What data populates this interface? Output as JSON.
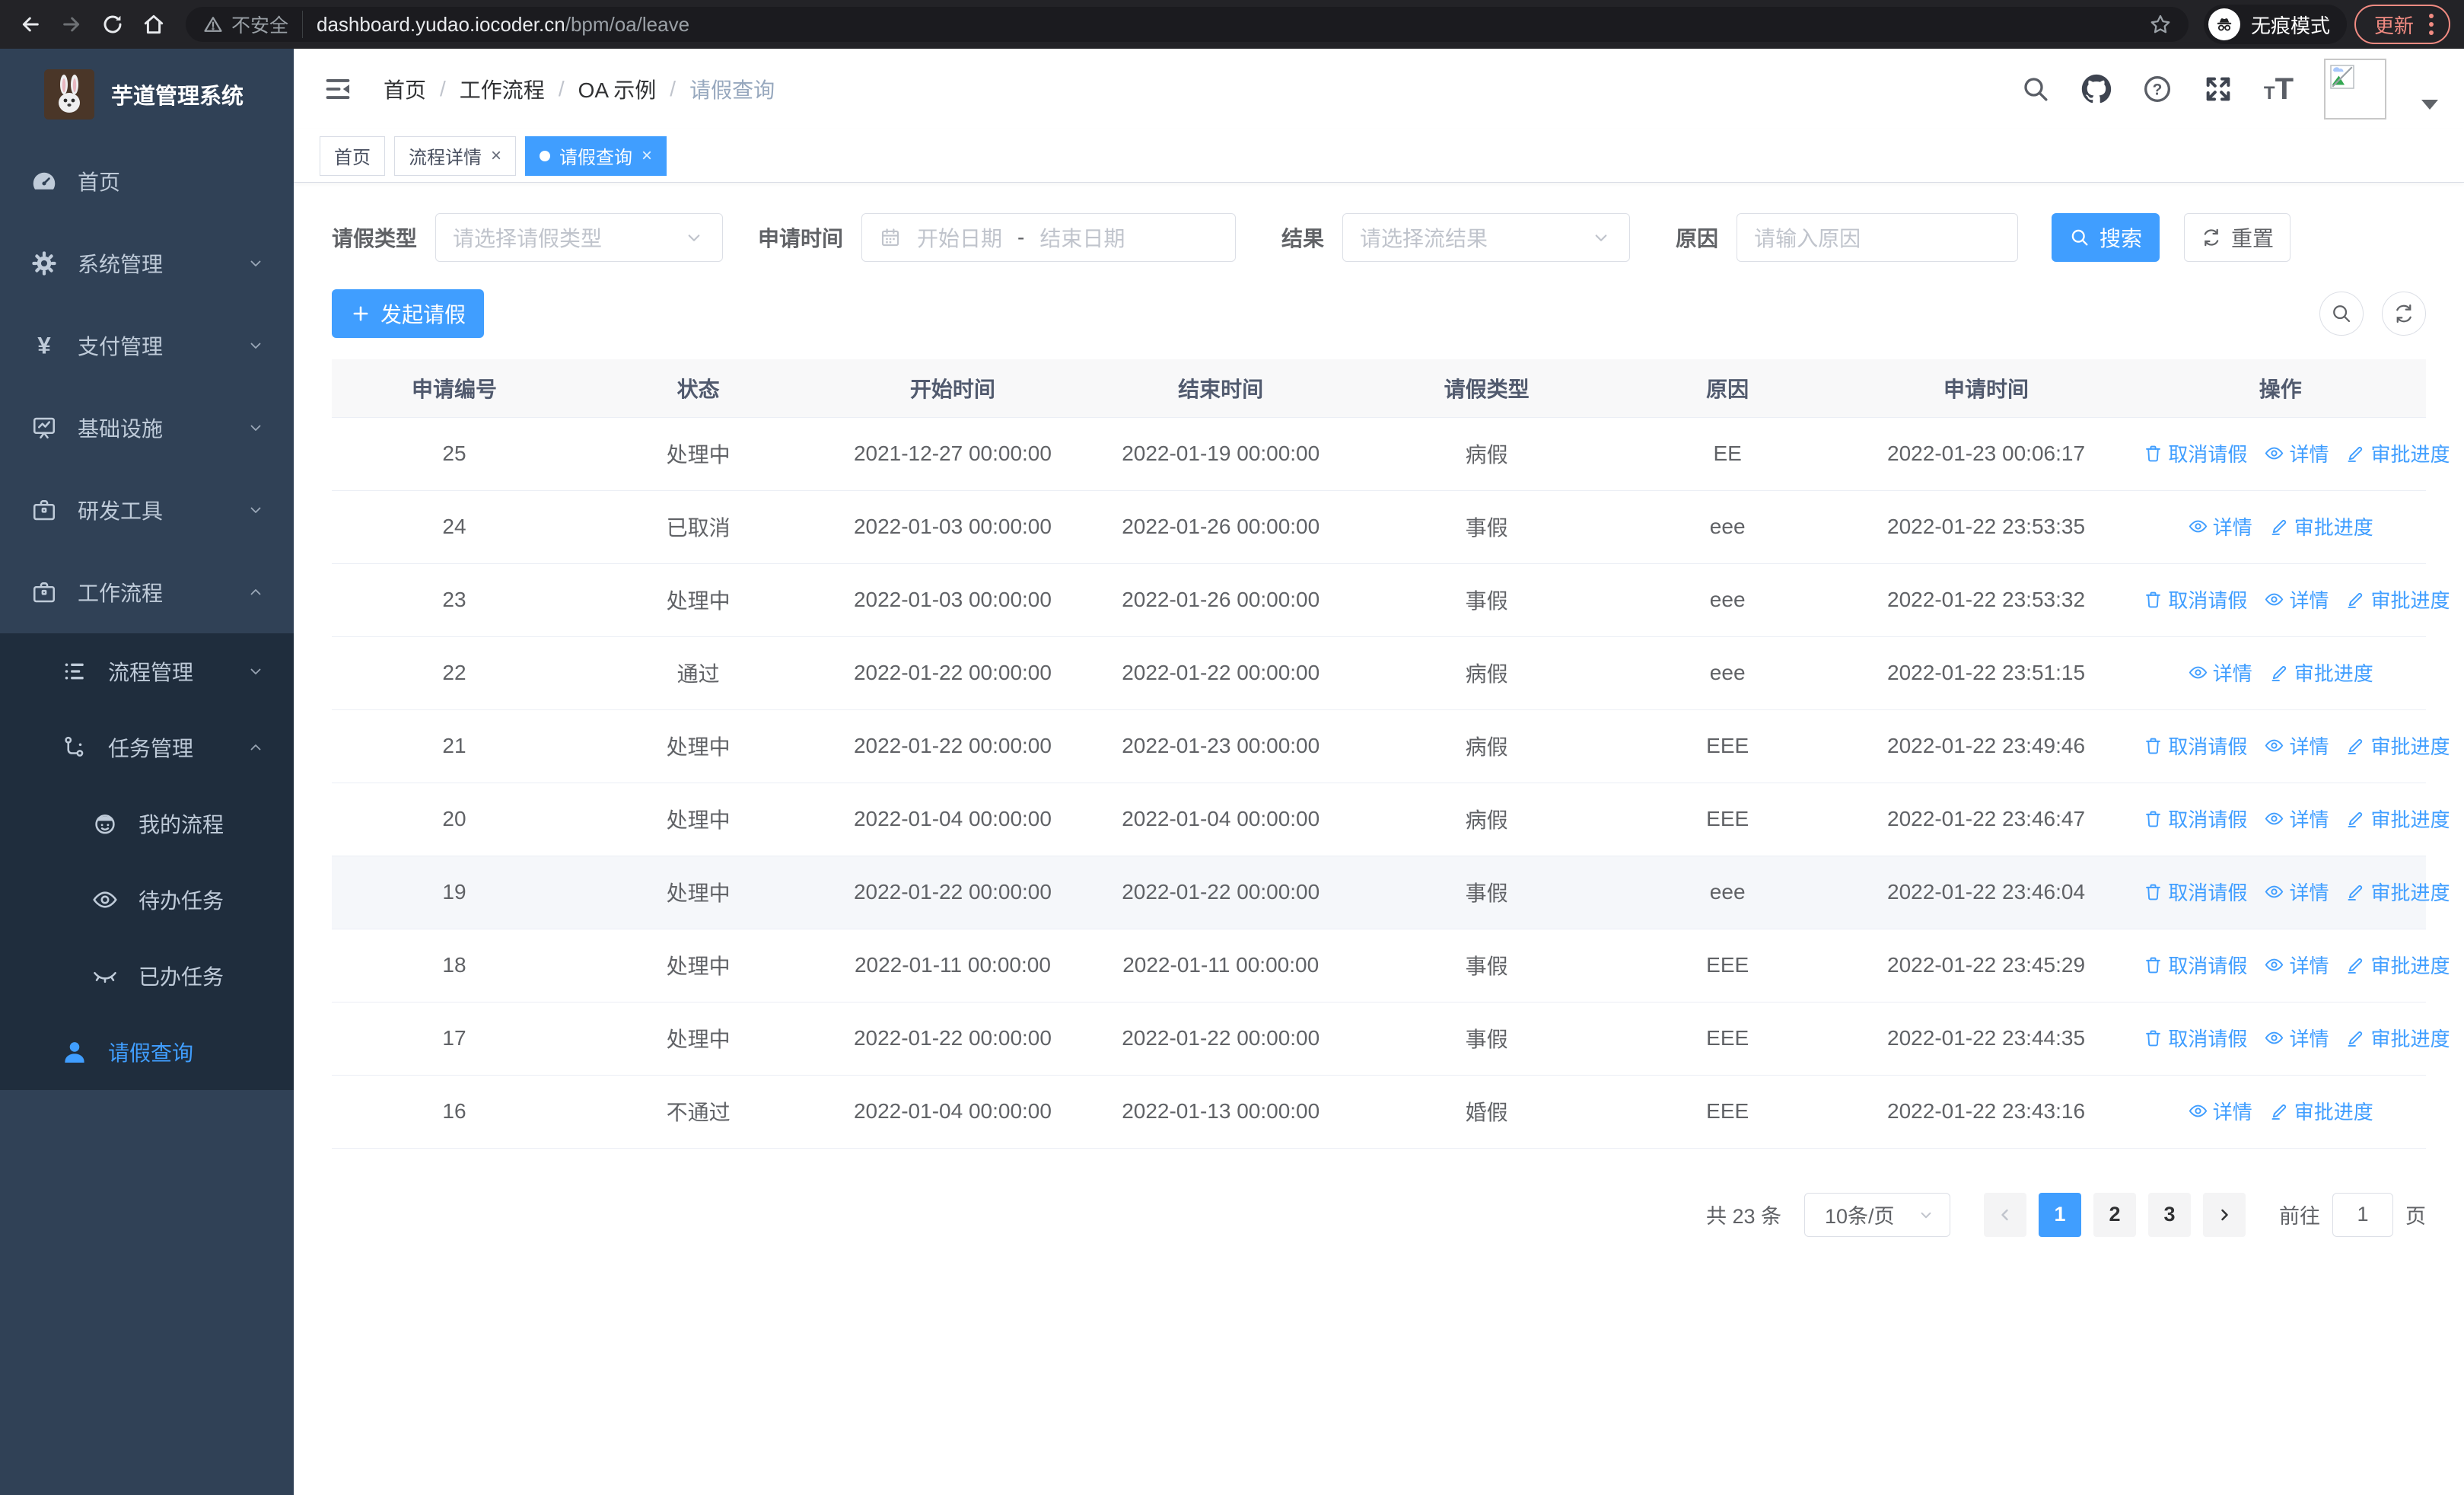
{
  "browser": {
    "security_label": "不安全",
    "url_host": "dashboard.yudao.iocoder.cn",
    "url_path": "/bpm/oa/leave",
    "incognito_label": "无痕模式",
    "update_label": "更新"
  },
  "sidebar": {
    "title": "芋道管理系统",
    "items": [
      {
        "label": "首页",
        "icon": "gauge-icon",
        "level": 1,
        "arrow": null,
        "submenu": false,
        "active": false
      },
      {
        "label": "系统管理",
        "icon": "gear-icon",
        "level": 1,
        "arrow": "down",
        "submenu": false,
        "active": false
      },
      {
        "label": "支付管理",
        "icon": "yen-icon",
        "level": 1,
        "arrow": "down",
        "submenu": false,
        "active": false
      },
      {
        "label": "基础设施",
        "icon": "monitor-icon",
        "level": 1,
        "arrow": "down",
        "submenu": false,
        "active": false
      },
      {
        "label": "研发工具",
        "icon": "briefcase-icon",
        "level": 1,
        "arrow": "down",
        "submenu": false,
        "active": false
      },
      {
        "label": "工作流程",
        "icon": "briefcase-icon",
        "level": 1,
        "arrow": "up",
        "submenu": false,
        "active": false
      },
      {
        "label": "流程管理",
        "icon": "list-tree-icon",
        "level": 2,
        "arrow": "down",
        "submenu": true,
        "active": false
      },
      {
        "label": "任务管理",
        "icon": "flow-icon",
        "level": 2,
        "arrow": "up",
        "submenu": true,
        "active": false
      },
      {
        "label": "我的流程",
        "icon": "face-icon",
        "level": 3,
        "arrow": null,
        "submenu": true,
        "active": false
      },
      {
        "label": "待办任务",
        "icon": "eye-icon",
        "level": 3,
        "arrow": null,
        "submenu": true,
        "active": false
      },
      {
        "label": "已办任务",
        "icon": "eye-closed-icon",
        "level": 3,
        "arrow": null,
        "submenu": true,
        "active": false
      },
      {
        "label": "请假查询",
        "icon": "user-icon",
        "level": 2,
        "arrow": null,
        "submenu": true,
        "active": true
      }
    ]
  },
  "header": {
    "breadcrumb": [
      "首页",
      "工作流程",
      "OA 示例",
      "请假查询"
    ],
    "icons": [
      "search-icon",
      "github-icon",
      "help-icon",
      "fullscreen-icon",
      "font-size-icon",
      "avatar",
      "dropdown-caret-icon"
    ]
  },
  "tabs": [
    {
      "label": "首页",
      "active": false,
      "closable": false
    },
    {
      "label": "流程详情",
      "active": false,
      "closable": true
    },
    {
      "label": "请假查询",
      "active": true,
      "closable": true
    }
  ],
  "filters": {
    "leave_type": {
      "label": "请假类型",
      "placeholder": "请选择请假类型"
    },
    "apply_time": {
      "label": "申请时间",
      "start_placeholder": "开始日期",
      "separator": "-",
      "end_placeholder": "结束日期"
    },
    "result": {
      "label": "结果",
      "placeholder": "请选择流结果"
    },
    "reason": {
      "label": "原因",
      "placeholder": "请输入原因"
    },
    "search_label": "搜索",
    "reset_label": "重置"
  },
  "toolbar": {
    "create_label": "发起请假"
  },
  "table": {
    "headers": [
      "申请编号",
      "状态",
      "开始时间",
      "结束时间",
      "请假类型",
      "原因",
      "申请时间",
      "操作"
    ],
    "action_labels": {
      "cancel": "取消请假",
      "detail": "详情",
      "progress": "审批进度"
    },
    "rows": [
      {
        "id": "25",
        "status": "处理中",
        "start": "2021-12-27 00:00:00",
        "end": "2022-01-19 00:00:00",
        "type": "病假",
        "reason": "EE",
        "applied": "2022-01-23 00:06:17",
        "actions": [
          "cancel",
          "detail",
          "progress"
        ],
        "highlighted": false
      },
      {
        "id": "24",
        "status": "已取消",
        "start": "2022-01-03 00:00:00",
        "end": "2022-01-26 00:00:00",
        "type": "事假",
        "reason": "eee",
        "applied": "2022-01-22 23:53:35",
        "actions": [
          "detail",
          "progress"
        ],
        "highlighted": false
      },
      {
        "id": "23",
        "status": "处理中",
        "start": "2022-01-03 00:00:00",
        "end": "2022-01-26 00:00:00",
        "type": "事假",
        "reason": "eee",
        "applied": "2022-01-22 23:53:32",
        "actions": [
          "cancel",
          "detail",
          "progress"
        ],
        "highlighted": false
      },
      {
        "id": "22",
        "status": "通过",
        "start": "2022-01-22 00:00:00",
        "end": "2022-01-22 00:00:00",
        "type": "病假",
        "reason": "eee",
        "applied": "2022-01-22 23:51:15",
        "actions": [
          "detail",
          "progress"
        ],
        "highlighted": false
      },
      {
        "id": "21",
        "status": "处理中",
        "start": "2022-01-22 00:00:00",
        "end": "2022-01-23 00:00:00",
        "type": "病假",
        "reason": "EEE",
        "applied": "2022-01-22 23:49:46",
        "actions": [
          "cancel",
          "detail",
          "progress"
        ],
        "highlighted": false
      },
      {
        "id": "20",
        "status": "处理中",
        "start": "2022-01-04 00:00:00",
        "end": "2022-01-04 00:00:00",
        "type": "病假",
        "reason": "EEE",
        "applied": "2022-01-22 23:46:47",
        "actions": [
          "cancel",
          "detail",
          "progress"
        ],
        "highlighted": false
      },
      {
        "id": "19",
        "status": "处理中",
        "start": "2022-01-22 00:00:00",
        "end": "2022-01-22 00:00:00",
        "type": "事假",
        "reason": "eee",
        "applied": "2022-01-22 23:46:04",
        "actions": [
          "cancel",
          "detail",
          "progress"
        ],
        "highlighted": true
      },
      {
        "id": "18",
        "status": "处理中",
        "start": "2022-01-11 00:00:00",
        "end": "2022-01-11 00:00:00",
        "type": "事假",
        "reason": "EEE",
        "applied": "2022-01-22 23:45:29",
        "actions": [
          "cancel",
          "detail",
          "progress"
        ],
        "highlighted": false
      },
      {
        "id": "17",
        "status": "处理中",
        "start": "2022-01-22 00:00:00",
        "end": "2022-01-22 00:00:00",
        "type": "事假",
        "reason": "EEE",
        "applied": "2022-01-22 23:44:35",
        "actions": [
          "cancel",
          "detail",
          "progress"
        ],
        "highlighted": false
      },
      {
        "id": "16",
        "status": "不通过",
        "start": "2022-01-04 00:00:00",
        "end": "2022-01-13 00:00:00",
        "type": "婚假",
        "reason": "EEE",
        "applied": "2022-01-22 23:43:16",
        "actions": [
          "detail",
          "progress"
        ],
        "highlighted": false
      }
    ]
  },
  "pagination": {
    "total": "共 23 条",
    "page_size": "10条/页",
    "pages": [
      "1",
      "2",
      "3"
    ],
    "active_page": "1",
    "goto_label": "前往",
    "goto_value": "1",
    "unit": "页"
  },
  "colors": {
    "primary": "#409eff",
    "sidebar_bg": "#304156",
    "submenu_bg": "#1f2d3d",
    "update_chip": "#f28b82",
    "link_blue": "#409eff"
  }
}
